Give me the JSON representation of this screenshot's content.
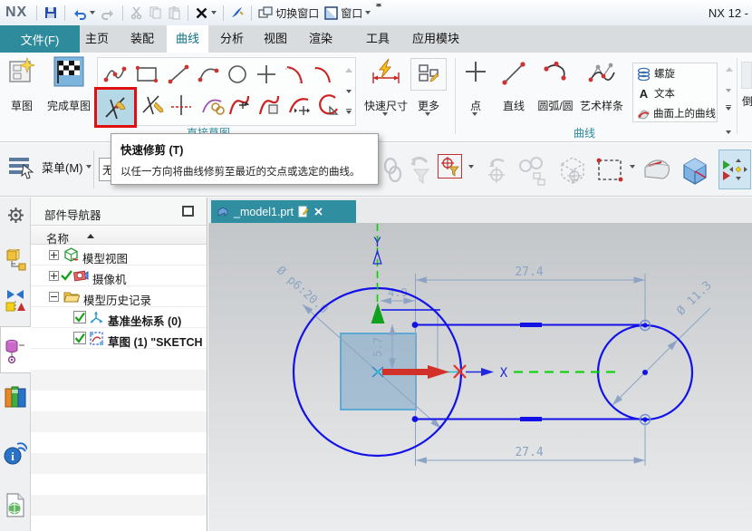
{
  "window": {
    "logo": "NX",
    "title": "NX 12 -"
  },
  "titlebar": {
    "switch_window": "切换窗口",
    "window_menu": "窗口",
    "icons": [
      "save-icon",
      "undo-icon",
      "redo-icon",
      "cut-icon",
      "copy-icon",
      "paste-icon",
      "delete-icon",
      "format-painter-icon"
    ]
  },
  "ribbon_tabs": {
    "file": "文件(F)",
    "items": [
      "主页",
      "装配",
      "曲线",
      "分析",
      "视图",
      "渲染",
      "工具",
      "应用模块"
    ],
    "active": "曲线"
  },
  "ribbon": {
    "sketch": "草图",
    "finish_sketch": "完成草图",
    "quick_dim": "快速尺寸",
    "more": "更多",
    "point": "点",
    "line": "直线",
    "arc_circle": "圆弧/圆",
    "studio_spline": "艺术样条",
    "helix": "螺旋",
    "text": "文本",
    "curve_on_surface": "曲面上的曲线",
    "group_direct_sketch": "直接草图",
    "group_curve": "曲线",
    "clipped_button": "倒",
    "gallery_icons": [
      "profile-icon",
      "rectangle-icon",
      "line-icon",
      "arc-icon",
      "circle-icon",
      "point-icon",
      "fillet-icon",
      "chamfer-icon",
      "quick-trim-icon",
      "quick-extend-icon",
      "make-corner-icon",
      "offset-curve-icon",
      "pattern-curve-icon",
      "mirror-curve-icon",
      "intersection-curve-icon"
    ]
  },
  "tooltip": {
    "title": "快速修剪 (T)",
    "body": "以任一方向将曲线修剪至最近的交点或选定的曲线。"
  },
  "cue_bar": {
    "menu": "菜单(M)",
    "filter_partial": "无"
  },
  "navigator": {
    "title": "部件导航器",
    "column": "名称",
    "rows": [
      {
        "label": "模型视图",
        "icon": "model-views-icon"
      },
      {
        "label": "摄像机",
        "icon": "camera-icon"
      },
      {
        "label": "模型历史记录",
        "icon": "history-folder-icon"
      },
      {
        "label": "基准坐标系 (0)",
        "icon": "datum-csys-icon"
      },
      {
        "label": "草图 (1) \"SKETCH",
        "icon": "sketch-icon"
      }
    ]
  },
  "viewport": {
    "tab": "_model1.prt"
  },
  "sketch": {
    "dim_top": "27.4",
    "dim_bottom": "27.4",
    "dim_width": "4.9",
    "dim_height": "5.7",
    "dim_big_circle": "Ø p6:20.0",
    "dim_small_circle": "Ø 11.3",
    "axis_x": "X",
    "axis_y": "Y"
  }
}
